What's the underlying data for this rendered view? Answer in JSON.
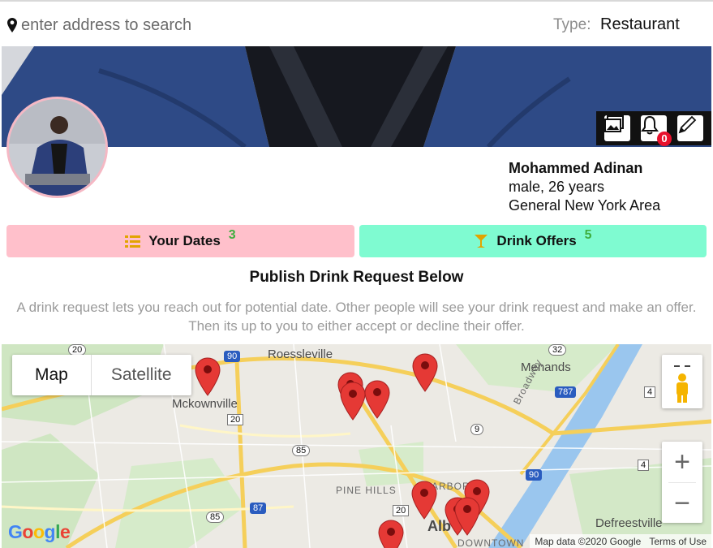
{
  "search": {
    "placeholder": "enter address to search"
  },
  "type_filter": {
    "label": "Type:",
    "value": "Restaurant"
  },
  "notifications": {
    "count": "0"
  },
  "profile": {
    "name": "Mohammed Adinan",
    "details": "male, 26 years",
    "location": "General New York Area"
  },
  "tabs": {
    "dates": {
      "label": "Your Dates",
      "count": "3"
    },
    "offers": {
      "label": "Drink Offers",
      "count": "5"
    }
  },
  "publish": {
    "title": "Publish Drink Request Below",
    "description": "A drink request lets you reach out for potential date. Other people will see your drink request and make an offer. Then its up to you to either accept or decline their offer."
  },
  "map": {
    "type_map": "Map",
    "type_satellite": "Satellite",
    "labels": {
      "roessleville": "Roessleville",
      "menands": "Menands",
      "mckownville": "Mckownville",
      "pine_hills": "PINE HILLS",
      "albany": "Alb",
      "downtown": "DOWNTOWN",
      "arbor": "ARBOR",
      "defreestville": "Defreestville",
      "broadway": "Broadway"
    },
    "shields": [
      "20",
      "90",
      "32",
      "787",
      "4",
      "9",
      "20",
      "85",
      "90",
      "87",
      "85",
      "20",
      "4"
    ],
    "zoom_in": "+",
    "zoom_out": "−",
    "logo": "Google",
    "attribution": "Map data ©2020 Google",
    "terms": "Terms of Use"
  },
  "colors": {
    "dates_button": "#ffc0cb",
    "offers_button": "#7ffbd1",
    "count": "#3fae3f",
    "marker": "#e53935",
    "badge": "#e8112d"
  }
}
